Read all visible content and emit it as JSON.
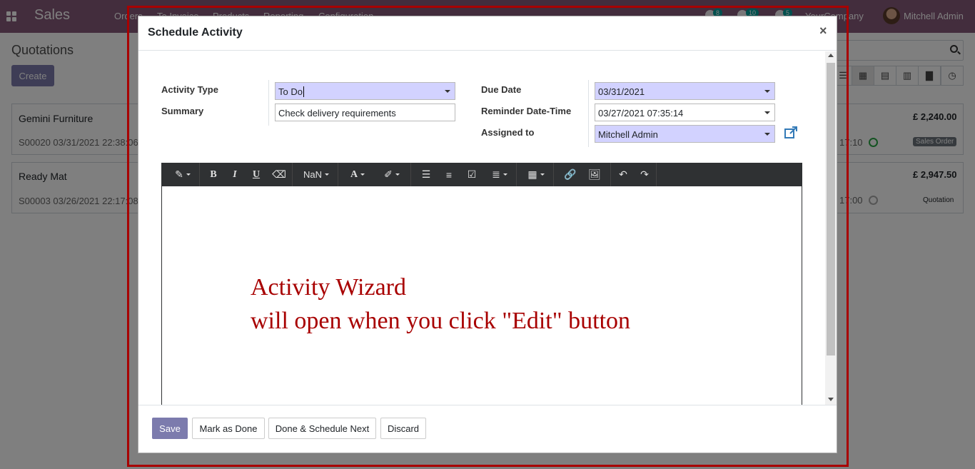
{
  "app": {
    "name": "Sales",
    "menu": [
      "Orders",
      "To Invoice",
      "Products",
      "Reporting",
      "Configuration"
    ],
    "badges": {
      "activities": "8",
      "messages": "10",
      "chat": "5"
    },
    "company": "YourCompany",
    "user": "Mitchell Admin"
  },
  "page": {
    "title": "Quotations",
    "create_label": "Create"
  },
  "cards": [
    {
      "customer": "Gemini Furniture",
      "ref": "S00020 03/31/2021 22:38:06",
      "amount": "£ 2,240.00",
      "time_tail": "17:10",
      "tag": "Sales Order"
    },
    {
      "customer": "Ready Mat",
      "ref": "S00003 03/26/2021 22:17:08",
      "amount": "£ 2,947.50",
      "time_tail": "17:00",
      "tag": "Quotation"
    }
  ],
  "dialog": {
    "title": "Schedule Activity",
    "close": "×",
    "fields": {
      "activity_type": {
        "label": "Activity Type",
        "value": "To Do"
      },
      "summary": {
        "label": "Summary",
        "value": "Check delivery requirements"
      },
      "due_date": {
        "label": "Due Date",
        "value": "03/31/2021"
      },
      "reminder": {
        "label": "Reminder Date-Time",
        "value": "03/27/2021 07:35:14"
      },
      "assigned_to": {
        "label": "Assigned to",
        "value": "Mitchell Admin"
      }
    },
    "toolbar": {
      "font_size": "NaN",
      "bold": "B",
      "italic": "I",
      "underline": "U",
      "font_color": "A"
    },
    "editor_overlay": {
      "line1": "Activity Wizard",
      "line2": "will open when you click \"Edit\" button"
    },
    "buttons": {
      "save": "Save",
      "mark_done": "Mark as Done",
      "done_next": "Done & Schedule Next",
      "discard": "Discard"
    }
  },
  "colors": {
    "brand": "#875a7b",
    "primary_button": "#7c7bad",
    "required_field": "#d2d2ff",
    "annotation_red": "#a80000"
  }
}
